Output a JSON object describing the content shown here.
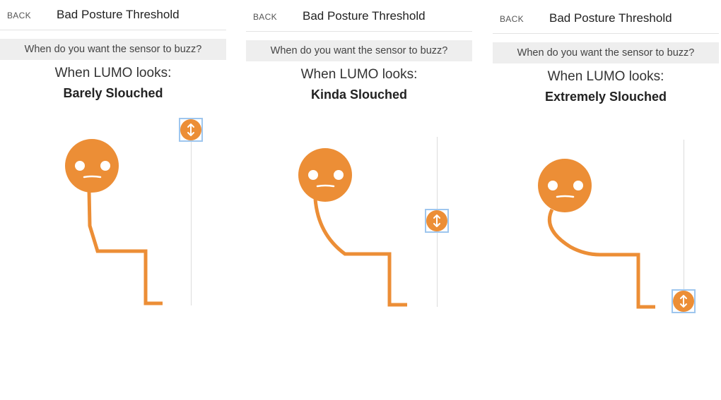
{
  "accent_color": "#ec8e36",
  "screens": [
    {
      "back_label": "BACK",
      "title": "Bad Posture Threshold",
      "prompt": "When do you want the sensor to buzz?",
      "looks_label": "When LUMO looks:",
      "level": "Barely Slouched",
      "slider_position": 0
    },
    {
      "back_label": "BACK",
      "title": "Bad Posture Threshold",
      "prompt": "When do you want the sensor to buzz?",
      "looks_label": "When LUMO looks:",
      "level": "Kinda Slouched",
      "slider_position": 0.5
    },
    {
      "back_label": "BACK",
      "title": "Bad Posture Threshold",
      "prompt": "When do you want the sensor to buzz?",
      "looks_label": "When LUMO looks:",
      "level": "Extremely Slouched",
      "slider_position": 1
    }
  ]
}
